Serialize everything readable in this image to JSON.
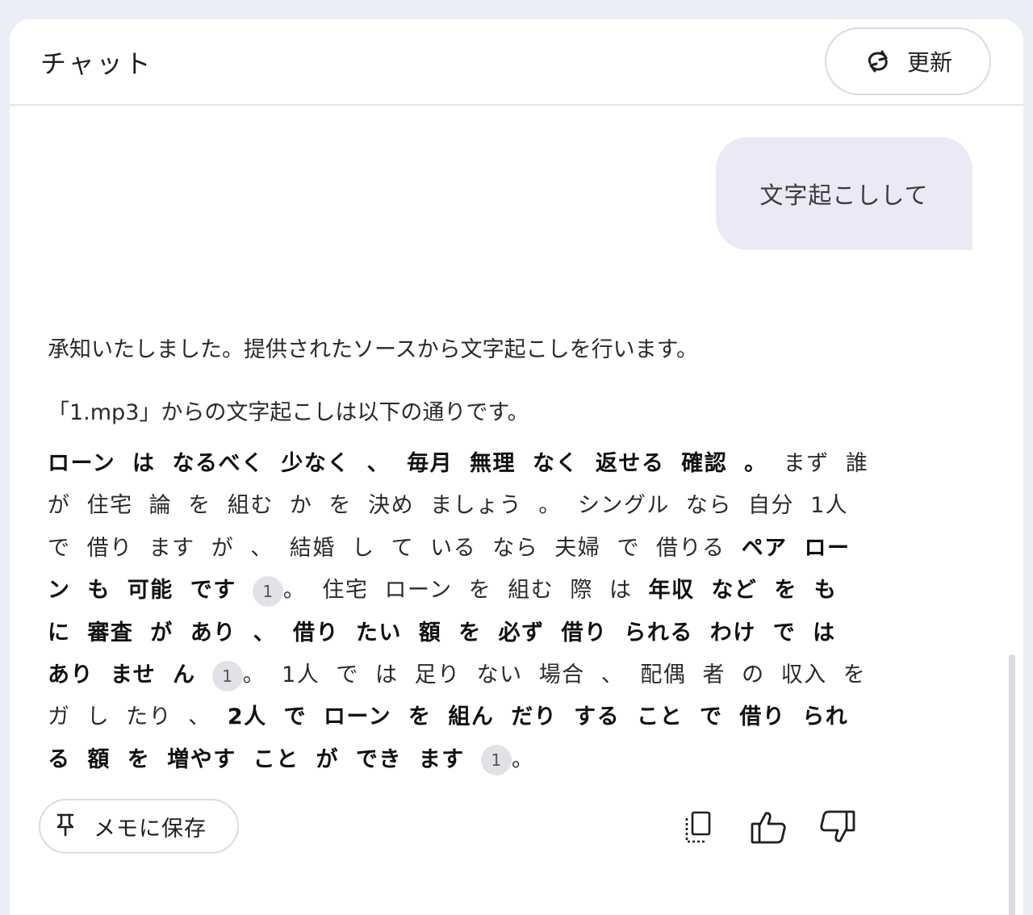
{
  "header": {
    "title": "チャット",
    "refresh_label": "更新"
  },
  "conversation": {
    "user_message": "文字起こしして",
    "answer": {
      "intro": "承知いたしました。提供されたソースから文字起こしを行います。",
      "file_line": "「1.mp3」からの文字起こしは以下の通りです。",
      "transcript": [
        {
          "text": "ローン は なるべく 少なく 、 毎月 無理 なく 返せる 確認 。",
          "bold": true
        },
        {
          "text": " まず 誰 が 住宅 論 を 組む か を 決め ましょう 。 シングル なら 自分 1人 で 借り ます が 、 結婚 し て いる なら 夫婦 で 借りる ",
          "bold": false
        },
        {
          "text": "ペア ローン も 可能 です",
          "bold": true
        },
        {
          "cite": "1"
        },
        {
          "text": "。 住宅 ローン を 組む 際 は ",
          "bold": false
        },
        {
          "text": "年収 など を も に 審査 が あり 、 借り たい 額 を 必ず 借り られる わけ で は あり ませ ん",
          "bold": true
        },
        {
          "cite": "1"
        },
        {
          "text": "。 1人 で は 足り ない 場合 、 配偶 者 の 収入 を ガ し たり 、 ",
          "bold": false
        },
        {
          "text": "2人 で ローン を 組ん だり する こと で 借り られる 額 を 増やす こと が でき ます",
          "bold": true
        },
        {
          "cite": "1"
        },
        {
          "text": "。",
          "bold": false
        }
      ]
    },
    "actions": {
      "save_memo_label": "メモに保存",
      "copy_icon": "copy-icon",
      "thumbs_up_icon": "thumbs-up-icon",
      "thumbs_down_icon": "thumbs-down-icon"
    }
  }
}
